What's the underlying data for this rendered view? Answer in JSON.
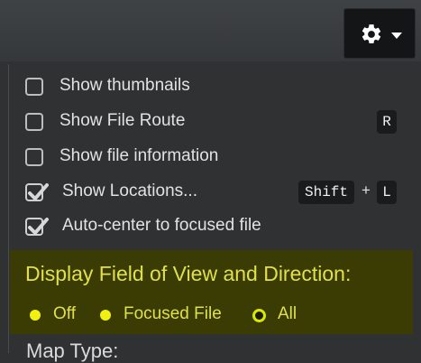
{
  "settings_button": {
    "icon": "gear-icon",
    "caret_icon": "caret-down-icon"
  },
  "options": [
    {
      "label": "Show thumbnails",
      "checked": false
    },
    {
      "label": "Show File Route",
      "checked": false,
      "shortcut": [
        "R"
      ]
    },
    {
      "label": "Show file information",
      "checked": false
    },
    {
      "label": "Show Locations...",
      "checked": true,
      "shortcut": [
        "Shift",
        "L"
      ],
      "shortcut_joiner": "+"
    },
    {
      "label": "Auto-center to focused file",
      "checked": true
    }
  ],
  "fov": {
    "title": "Display Field of View and Direction:",
    "choices": [
      {
        "label": "Off",
        "selected": false
      },
      {
        "label": "Focused File",
        "selected": false
      },
      {
        "label": "All",
        "selected": true
      }
    ],
    "highlight_color": "#3b3c03",
    "text_color": "#e0e04a"
  },
  "map_type_label": "Map Type:"
}
